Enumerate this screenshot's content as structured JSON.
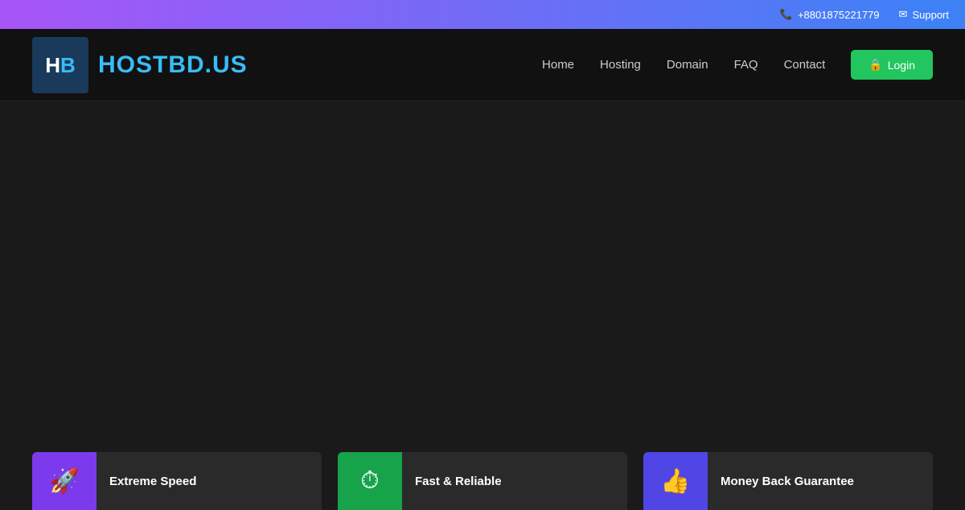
{
  "topbar": {
    "phone": "+8801875221779",
    "support": "Support",
    "phone_icon": "📞",
    "email_icon": "✉"
  },
  "header": {
    "logo_text": "HB",
    "logo_h": "H",
    "logo_b": "B",
    "brand": "HOSTBD.US",
    "nav": [
      {
        "label": "Home",
        "id": "home"
      },
      {
        "label": "Hosting",
        "id": "hosting"
      },
      {
        "label": "Domain",
        "id": "domain"
      },
      {
        "label": "FAQ",
        "id": "faq"
      },
      {
        "label": "Contact",
        "id": "contact"
      }
    ],
    "login_label": "Login",
    "lock_icon": "🔒"
  },
  "features": [
    {
      "id": "extreme-speed",
      "icon": "🚀",
      "icon_color": "purple",
      "label": "Extreme Speed"
    },
    {
      "id": "fast-reliable",
      "icon": "⏱",
      "icon_color": "green",
      "label": "Fast & Reliable"
    },
    {
      "id": "money-back",
      "icon": "👍",
      "icon_color": "indigo",
      "label": "Money Back Guarantee"
    }
  ]
}
